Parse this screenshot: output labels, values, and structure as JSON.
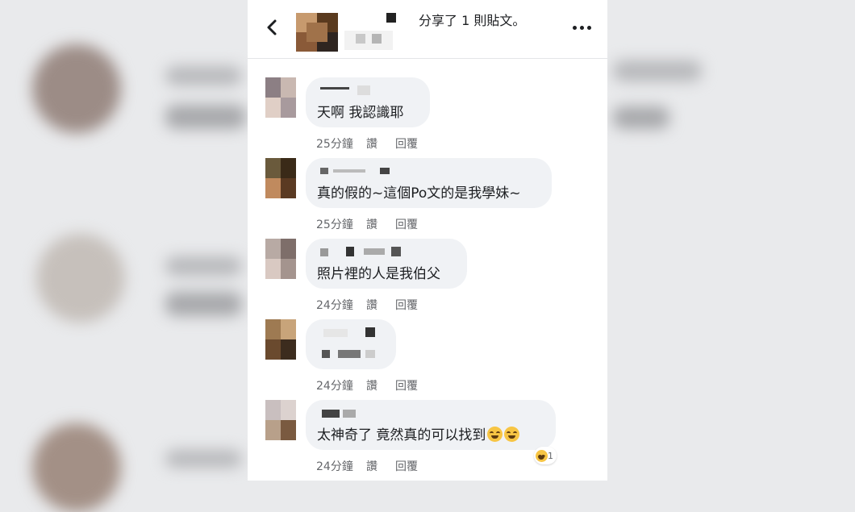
{
  "header": {
    "title": "分享了 1 則貼文。"
  },
  "comments": [
    {
      "text": "天啊 我認識耶",
      "time": "25分鐘",
      "like": "讚",
      "reply": "回覆",
      "emojis": 0,
      "reaction_count": ""
    },
    {
      "text": "真的假的~這個Po文的是我學妹~",
      "time": "25分鐘",
      "like": "讚",
      "reply": "回覆",
      "emojis": 0,
      "reaction_count": ""
    },
    {
      "text": "照片裡的人是我伯父",
      "time": "24分鐘",
      "like": "讚",
      "reply": "回覆",
      "emojis": 0,
      "reaction_count": ""
    },
    {
      "text": "",
      "time": "24分鐘",
      "like": "讚",
      "reply": "回覆",
      "emojis": 0,
      "reaction_count": ""
    },
    {
      "text": "太神奇了 竟然真的可以找到",
      "time": "24分鐘",
      "like": "讚",
      "reply": "回覆",
      "emojis": 2,
      "reaction_count": "1"
    }
  ],
  "colors": {
    "bubble": "#f0f2f5",
    "text": "#1c1e21",
    "meta": "#65676b",
    "background": "#e9eaec",
    "emoji": "#f7c544"
  },
  "icons": [
    "back-arrow-icon",
    "more-options-icon",
    "laughing-emoji-icon",
    "haha-reaction-icon"
  ]
}
